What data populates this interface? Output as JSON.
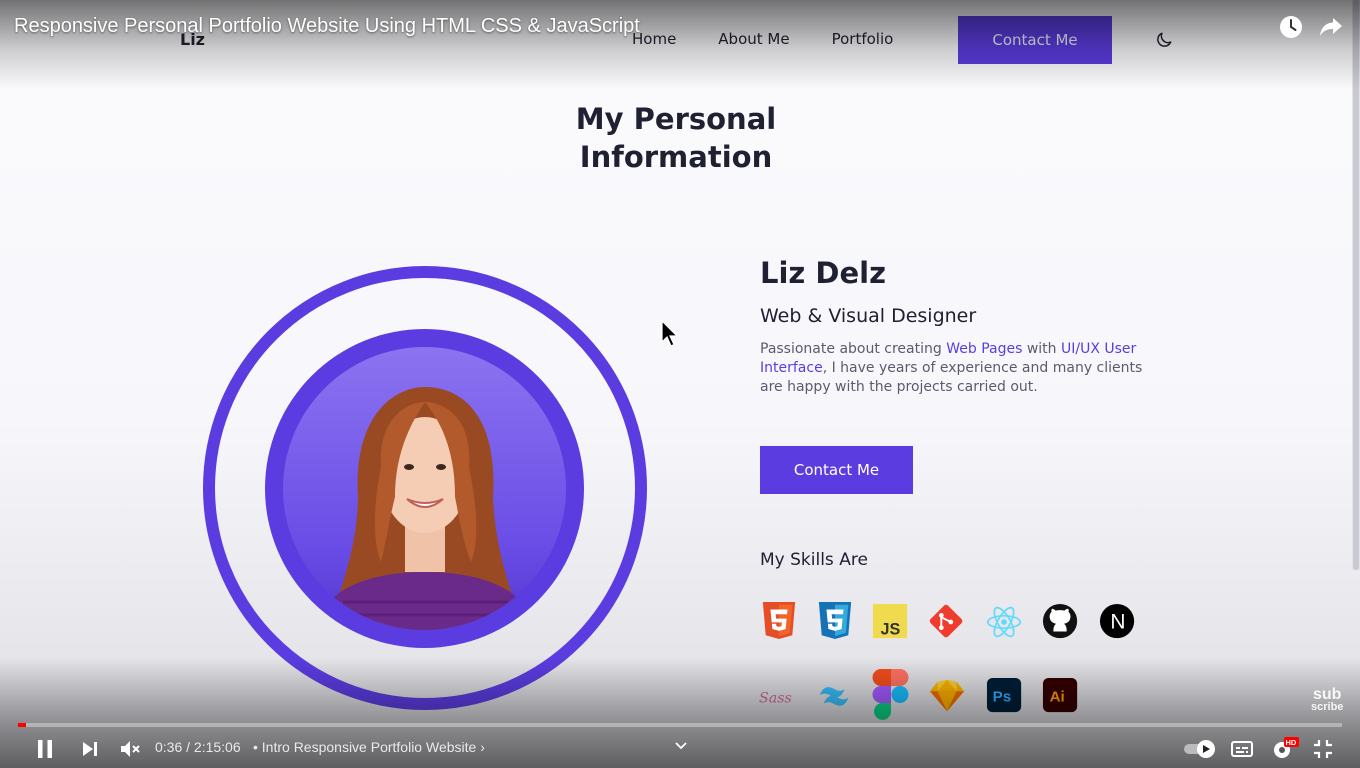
{
  "video": {
    "title": "Responsive Personal Portfolio Website Using HTML CSS & JavaScript",
    "current_time": "0:36",
    "duration": "2:15:06",
    "time_label": "0:36 / 2:15:06",
    "chapter": "• Intro Responsive Portfolio Website ›",
    "progress_fraction": 0.0044,
    "quality_badge": "HD",
    "watermark_top": "sub",
    "watermark_bottom": "scribe",
    "icons": [
      "watch-later-icon",
      "share-icon",
      "pause-icon",
      "next-icon",
      "mute-icon",
      "autoplay-toggle-icon",
      "subtitles-icon",
      "settings-icon",
      "exit-fullscreen-icon"
    ]
  },
  "site": {
    "logo": "Liz",
    "nav": [
      "Home",
      "About Me",
      "Portfolio"
    ],
    "nav_cta": "Contact Me",
    "section_title_line1": "My Personal",
    "section_title_line2": "Information",
    "name": "Liz Delz",
    "role": "Web & Visual Designer",
    "bio": {
      "part1": "Passionate about creating ",
      "hl1": "Web Pages",
      "part2": " with ",
      "hl2": "UI/UX User Interface",
      "part3": ", I have years of experience and many clients are happy with the projects carried out."
    },
    "cta": "Contact Me",
    "skills_title": "My Skills Are",
    "skills": [
      "html5-icon",
      "css3-icon",
      "javascript-icon",
      "git-icon",
      "react-icon",
      "github-icon",
      "nextjs-icon",
      "sass-icon",
      "tailwind-icon",
      "figma-icon",
      "sketch-icon",
      "photoshop-icon",
      "illustrator-icon"
    ],
    "skill_badges": {
      "js": "JS",
      "ps": "Ps",
      "ai": "Ai",
      "next": "N",
      "sass": "Sass"
    }
  },
  "colors": {
    "accent": "#5b3ce0",
    "text_dark": "#202033",
    "text_muted": "#5b5b6d",
    "progress": "#ff0000"
  }
}
